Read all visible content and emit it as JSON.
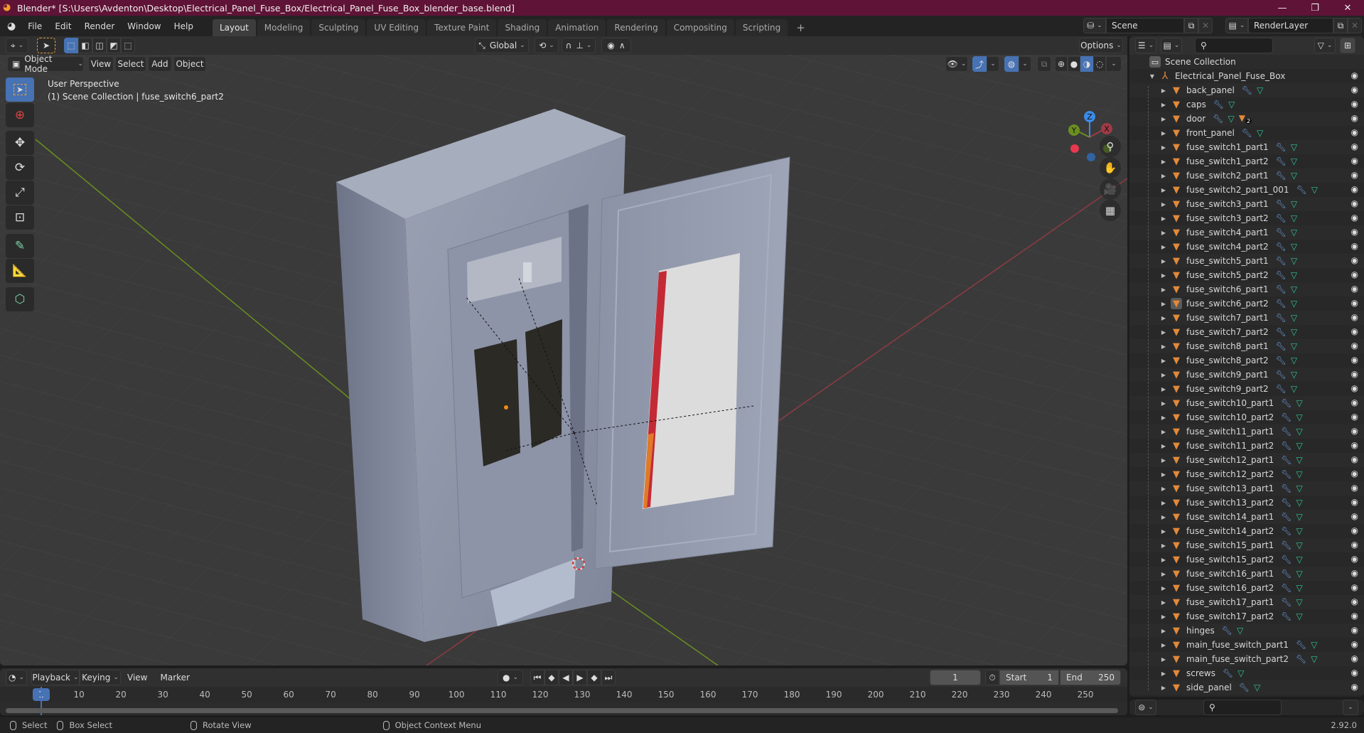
{
  "window": {
    "title": "Blender* [S:\\Users\\Avdenton\\Desktop\\Electrical_Panel_Fuse_Box/Electrical_Panel_Fuse_Box_blender_base.blend]",
    "minimize": "—",
    "maximize": "❐",
    "close": "✕",
    "titlebar_color": "#5f1336"
  },
  "menubar": {
    "items": [
      "File",
      "Edit",
      "Render",
      "Window",
      "Help"
    ],
    "workspaces": [
      "Layout",
      "Modeling",
      "Sculpting",
      "UV Editing",
      "Texture Paint",
      "Shading",
      "Animation",
      "Rendering",
      "Compositing",
      "Scripting"
    ],
    "active_workspace": "Layout",
    "add_workspace": "+",
    "scene": "Scene",
    "view_layer": "RenderLayer"
  },
  "viewport": {
    "tool_header": {
      "orientation": "Global",
      "options": "Options"
    },
    "mode": "Object Mode",
    "menus": [
      "View",
      "Select",
      "Add",
      "Object"
    ],
    "info_line1": "User Perspective",
    "info_line2": "(1) Scene Collection | fuse_switch6_part2",
    "gizmo": {
      "x": "X",
      "y": "Y",
      "z": "Z"
    },
    "accent": "#4772b3"
  },
  "outliner": {
    "search_placeholder": "",
    "root": "Scene Collection",
    "collection": "Electrical_Panel_Fuse_Box",
    "selected": "fuse_switch6_part2",
    "objects": [
      {
        "name": "back_panel",
        "extra": ""
      },
      {
        "name": "caps",
        "extra": ""
      },
      {
        "name": "door",
        "extra": "2"
      },
      {
        "name": "front_panel",
        "extra": ""
      },
      {
        "name": "fuse_switch1_part1",
        "extra": ""
      },
      {
        "name": "fuse_switch1_part2",
        "extra": ""
      },
      {
        "name": "fuse_switch2_part1",
        "extra": ""
      },
      {
        "name": "fuse_switch2_part1_001",
        "extra": ""
      },
      {
        "name": "fuse_switch3_part1",
        "extra": ""
      },
      {
        "name": "fuse_switch3_part2",
        "extra": ""
      },
      {
        "name": "fuse_switch4_part1",
        "extra": ""
      },
      {
        "name": "fuse_switch4_part2",
        "extra": ""
      },
      {
        "name": "fuse_switch5_part1",
        "extra": ""
      },
      {
        "name": "fuse_switch5_part2",
        "extra": ""
      },
      {
        "name": "fuse_switch6_part1",
        "extra": ""
      },
      {
        "name": "fuse_switch6_part2",
        "extra": ""
      },
      {
        "name": "fuse_switch7_part1",
        "extra": ""
      },
      {
        "name": "fuse_switch7_part2",
        "extra": ""
      },
      {
        "name": "fuse_switch8_part1",
        "extra": ""
      },
      {
        "name": "fuse_switch8_part2",
        "extra": ""
      },
      {
        "name": "fuse_switch9_part1",
        "extra": ""
      },
      {
        "name": "fuse_switch9_part2",
        "extra": ""
      },
      {
        "name": "fuse_switch10_part1",
        "extra": ""
      },
      {
        "name": "fuse_switch10_part2",
        "extra": ""
      },
      {
        "name": "fuse_switch11_part1",
        "extra": ""
      },
      {
        "name": "fuse_switch11_part2",
        "extra": ""
      },
      {
        "name": "fuse_switch12_part1",
        "extra": ""
      },
      {
        "name": "fuse_switch12_part2",
        "extra": ""
      },
      {
        "name": "fuse_switch13_part1",
        "extra": ""
      },
      {
        "name": "fuse_switch13_part2",
        "extra": ""
      },
      {
        "name": "fuse_switch14_part1",
        "extra": ""
      },
      {
        "name": "fuse_switch14_part2",
        "extra": ""
      },
      {
        "name": "fuse_switch15_part1",
        "extra": ""
      },
      {
        "name": "fuse_switch15_part2",
        "extra": ""
      },
      {
        "name": "fuse_switch16_part1",
        "extra": ""
      },
      {
        "name": "fuse_switch16_part2",
        "extra": ""
      },
      {
        "name": "fuse_switch17_part1",
        "extra": ""
      },
      {
        "name": "fuse_switch17_part2",
        "extra": ""
      },
      {
        "name": "hinges",
        "extra": ""
      },
      {
        "name": "main_fuse_switch_part1",
        "extra": ""
      },
      {
        "name": "main_fuse_switch_part2",
        "extra": ""
      },
      {
        "name": "screws",
        "extra": ""
      },
      {
        "name": "side_panel",
        "extra": ""
      }
    ]
  },
  "timeline": {
    "menus": [
      "Playback",
      "Keying",
      "View",
      "Marker"
    ],
    "current_frame": "1",
    "start_label": "Start",
    "start": "1",
    "end_label": "End",
    "end": "250",
    "ticks": [
      "10",
      "20",
      "30",
      "40",
      "50",
      "60",
      "70",
      "80",
      "90",
      "100",
      "110",
      "120",
      "130",
      "140",
      "150",
      "160",
      "170",
      "180",
      "190",
      "200",
      "210",
      "220",
      "230",
      "240",
      "250"
    ]
  },
  "statusbar": {
    "select": "Select",
    "box_select": "Box Select",
    "rotate_view": "Rotate View",
    "context_menu": "Object Context Menu",
    "version": "2.92.0"
  }
}
